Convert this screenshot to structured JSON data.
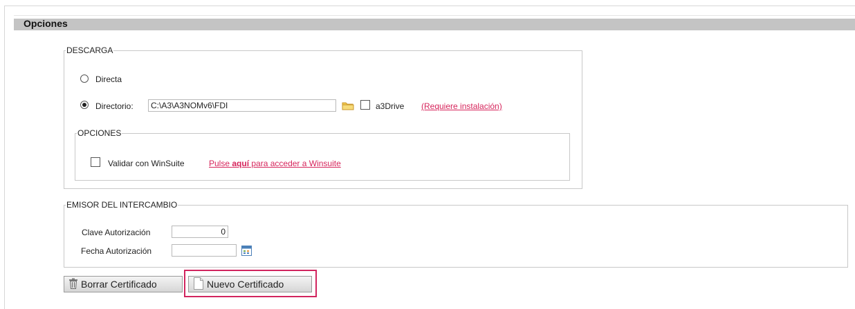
{
  "header": {
    "title": "Opciones"
  },
  "descarga": {
    "legend": "DESCARGA",
    "directa_label": "Directa",
    "directorio_label": "Directorio:",
    "directorio_value": "C:\\A3\\A3NOMv6\\FDI",
    "a3drive_label": "a3Drive",
    "requiere_link": "(Requiere instalación)",
    "selected": "directorio"
  },
  "opciones": {
    "legend": "OPCIONES",
    "validar_label": "Validar con WinSuite",
    "link_prefix": "Pulse ",
    "link_bold": "aquí",
    "link_suffix": " para acceder a Winsuite"
  },
  "emisor": {
    "legend": "EMISOR DEL INTERCAMBIO",
    "clave_label": "Clave Autorización",
    "clave_value": "0",
    "fecha_label": "Fecha Autorización",
    "fecha_value": ""
  },
  "toolbar": {
    "borrar_label": "Borrar Certificado",
    "nuevo_label": "Nuevo Certificado"
  },
  "colors": {
    "accent": "#d6245b",
    "header_bar": "#c4c4c4"
  }
}
